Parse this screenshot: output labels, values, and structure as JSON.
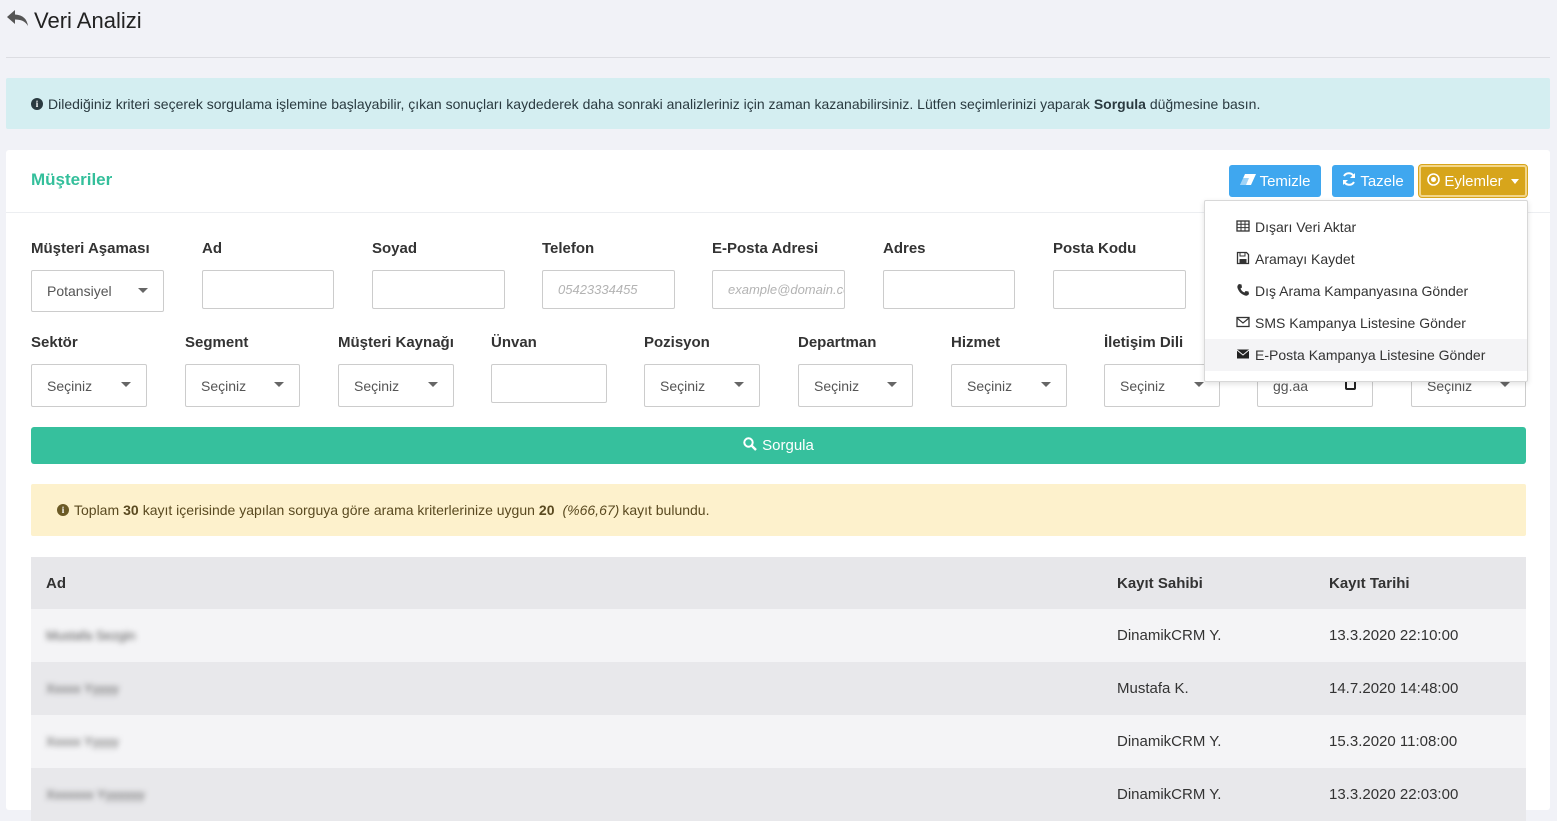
{
  "page": {
    "title": "Veri Analizi"
  },
  "info_alert": {
    "text_before": "Dilediğiniz kriteri seçerek sorgulama işlemine başlayabilir, çıkan sonuçları kaydederek daha sonraki analizleriniz için zaman kazanabilirsiniz. Lütfen seçimlerinizi yaparak",
    "bold": "Sorgula",
    "text_after": "düğmesine basın."
  },
  "card": {
    "title": "Müşteriler",
    "buttons": {
      "clear": "Temizle",
      "refresh": "Tazele",
      "actions": "Eylemler"
    }
  },
  "filters_row1": [
    {
      "label": "Müşteri Aşaması",
      "value": "Potansiyel",
      "type": "select"
    },
    {
      "label": "Ad",
      "value": "",
      "type": "text"
    },
    {
      "label": "Soyad",
      "value": "",
      "type": "text"
    },
    {
      "label": "Telefon",
      "placeholder": "05423334455",
      "type": "text"
    },
    {
      "label": "E-Posta Adresi",
      "placeholder": "example@domain.com",
      "type": "text"
    },
    {
      "label": "Adres",
      "value": "",
      "type": "text"
    },
    {
      "label": "Posta Kodu",
      "value": "",
      "type": "text"
    }
  ],
  "filters_row2": [
    {
      "label": "Sektör",
      "value": "Seçiniz",
      "type": "select"
    },
    {
      "label": "Segment",
      "value": "Seçiniz",
      "type": "select"
    },
    {
      "label": "Müşteri Kaynağı",
      "value": "Seçiniz",
      "type": "select"
    },
    {
      "label": "Ünvan",
      "value": "",
      "type": "text"
    },
    {
      "label": "Pozisyon",
      "value": "Seçiniz",
      "type": "select"
    },
    {
      "label": "Departman",
      "value": "Seçiniz",
      "type": "select"
    },
    {
      "label": "Hizmet",
      "value": "Seçiniz",
      "type": "select"
    },
    {
      "label": "İletişim Dili",
      "value": "Seçiniz",
      "type": "select"
    },
    {
      "placeholder": "gg.aa",
      "type": "date"
    },
    {
      "value": "Seçiniz",
      "type": "select"
    }
  ],
  "query_button": "Sorgula",
  "result_alert": {
    "t1": "Toplam",
    "total": "30",
    "t2": "kayıt içerisinde yapılan sorguya göre arama kriterlerinize uygun",
    "found": "20",
    "percent": "(%66,67)",
    "t3": "kayıt bulundu."
  },
  "table": {
    "headers": [
      "Ad",
      "Kayıt Sahibi",
      "Kayıt Tarihi"
    ],
    "rows": [
      {
        "name": "Mustafa Sezgin",
        "owner": "DinamikCRM Y.",
        "date": "13.3.2020 22:10:00"
      },
      {
        "name": "Xxxxx Yyyyy",
        "owner": "Mustafa K.",
        "date": "14.7.2020 14:48:00"
      },
      {
        "name": "Xxxxx Yyyyy",
        "owner": "DinamikCRM Y.",
        "date": "15.3.2020 11:08:00"
      },
      {
        "name": "Xxxxxxx Yyyyyyy",
        "owner": "DinamikCRM Y.",
        "date": "13.3.2020 22:03:00"
      }
    ]
  },
  "actions_menu": {
    "items": [
      {
        "label": "Dışarı Veri Aktar",
        "icon": "table-icon"
      },
      {
        "label": "Aramayı Kaydet",
        "icon": "save-icon"
      },
      {
        "label": "Dış Arama Kampanyasına Gönder",
        "icon": "phone-icon"
      },
      {
        "label": "SMS Kampanya Listesine Gönder",
        "icon": "envelope-outline-icon"
      },
      {
        "label": "E-Posta Kampanya Listesine Gönder",
        "icon": "envelope-icon"
      }
    ]
  },
  "colors": {
    "primary_green": "#34bf9b",
    "blue_button": "#3fa7ef",
    "actions_button": "#d7a51b"
  }
}
